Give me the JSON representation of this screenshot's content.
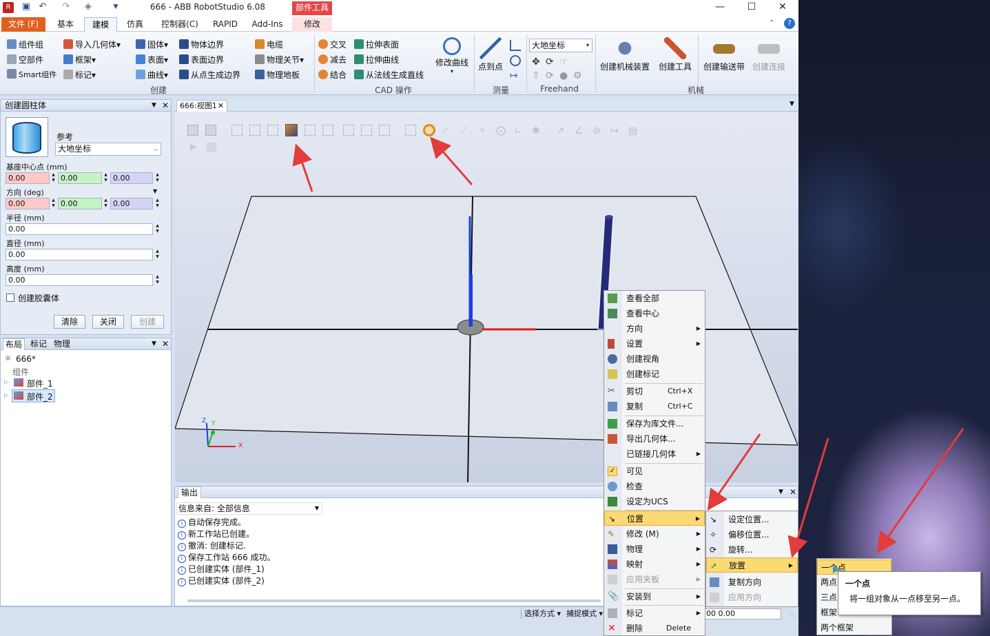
{
  "window": {
    "title": "666 - ABB RobotStudio 6.08",
    "context_tab_group": "部件工具"
  },
  "tabs": [
    "文件 (F)",
    "基本",
    "建模",
    "仿真",
    "控制器(C)",
    "RAPID",
    "Add-Ins",
    "修改"
  ],
  "ribbon": {
    "create": {
      "items": [
        "组件组",
        "空部件",
        "Smart组件",
        "导入几何体",
        "框架",
        "标记",
        "固体",
        "表面",
        "曲线",
        "物体边界",
        "表面边界",
        "从点生成边界",
        "电缆",
        "物理关节",
        "物理地板"
      ],
      "group_label": "创建"
    },
    "cad": {
      "items": [
        "交叉",
        "减去",
        "结合",
        "拉伸表面",
        "拉伸曲线",
        "从法线生成直线"
      ],
      "modify_curve": "修改曲线",
      "group_label": "CAD 操作"
    },
    "measure": {
      "point_to_point": "点到点",
      "group_label": "测量"
    },
    "freehand": {
      "frame_select": "大地坐标",
      "group_label": "Freehand"
    },
    "mechanism": {
      "items": [
        "创建机械装置",
        "创建工具",
        "创建输送带",
        "创建连接"
      ],
      "group_label": "机械"
    }
  },
  "create_cylinder": {
    "title": "创建圆柱体",
    "reference_label": "参考",
    "reference_value": "大地坐标",
    "base_center_label": "基座中心点 (mm)",
    "base_center": [
      "0.00",
      "0.00",
      "0.00"
    ],
    "orientation_label": "方向 (deg)",
    "orientation": [
      "0.00",
      "0.00",
      "0.00"
    ],
    "radius_label": "半径 (mm)",
    "radius": "0.00",
    "diameter_label": "直径 (mm)",
    "diameter": "0.00",
    "height_label": "高度 (mm)",
    "height": "0.00",
    "capsule_label": "创建胶囊体",
    "clear": "清除",
    "close": "关闭",
    "create": "创建"
  },
  "layout_panel": {
    "tabs": [
      "布局",
      "标记",
      "物理"
    ],
    "station": "666*",
    "group": "组件",
    "parts": [
      "部件_1",
      "部件_2"
    ]
  },
  "view": {
    "tab": "666:视图1",
    "axis_labels": [
      "Z",
      "Y",
      "X"
    ]
  },
  "output": {
    "title": "输出",
    "filter_label": "信息来自: 全部信息",
    "lines": [
      "自动保存完成。",
      "新工作站已创建。",
      "撤消: 创建标记.",
      "保存工作站 666 成功。",
      "已创建实体 (部件_1)",
      "已创建实体 (部件_2)"
    ]
  },
  "status": {
    "select_mode": "选择方式",
    "snap_mode": "捕捉模式",
    "coords": "00  0.00"
  },
  "context_menu": {
    "items": [
      {
        "label": "查看全部"
      },
      {
        "label": "查看中心"
      },
      {
        "label": "方向"
      },
      {
        "label": "设置"
      },
      {
        "label": "创建视角"
      },
      {
        "label": "创建标记"
      },
      {
        "label": "剪切",
        "shortcut": "Ctrl+X"
      },
      {
        "label": "复制",
        "shortcut": "Ctrl+C"
      },
      {
        "label": "保存为库文件..."
      },
      {
        "label": "导出几何体..."
      },
      {
        "label": "已链接几何体"
      },
      {
        "label": "可见"
      },
      {
        "label": "检查"
      },
      {
        "label": "设定为UCS"
      },
      {
        "label": "位置"
      },
      {
        "label": "修改 (M)"
      },
      {
        "label": "物理"
      },
      {
        "label": "映射"
      },
      {
        "label": "应用夹板"
      },
      {
        "label": "安装到"
      },
      {
        "label": "标记"
      },
      {
        "label": "删除",
        "shortcut": "Delete"
      }
    ]
  },
  "position_submenu": [
    "设定位置...",
    "偏移位置...",
    "旋转...",
    "放置",
    "复制方向",
    "应用方向"
  ],
  "place_submenu": [
    "一个点",
    "两点",
    "三点",
    "框架",
    "两个框架"
  ],
  "tooltip": {
    "title": "一个点",
    "body": "将一组对象从一点移至另一点。"
  },
  "colors": {
    "file_tab": "#e25f1e",
    "context_tab": "#e44545",
    "highlight": "#fbd974",
    "arrow": "#e23c3c"
  }
}
